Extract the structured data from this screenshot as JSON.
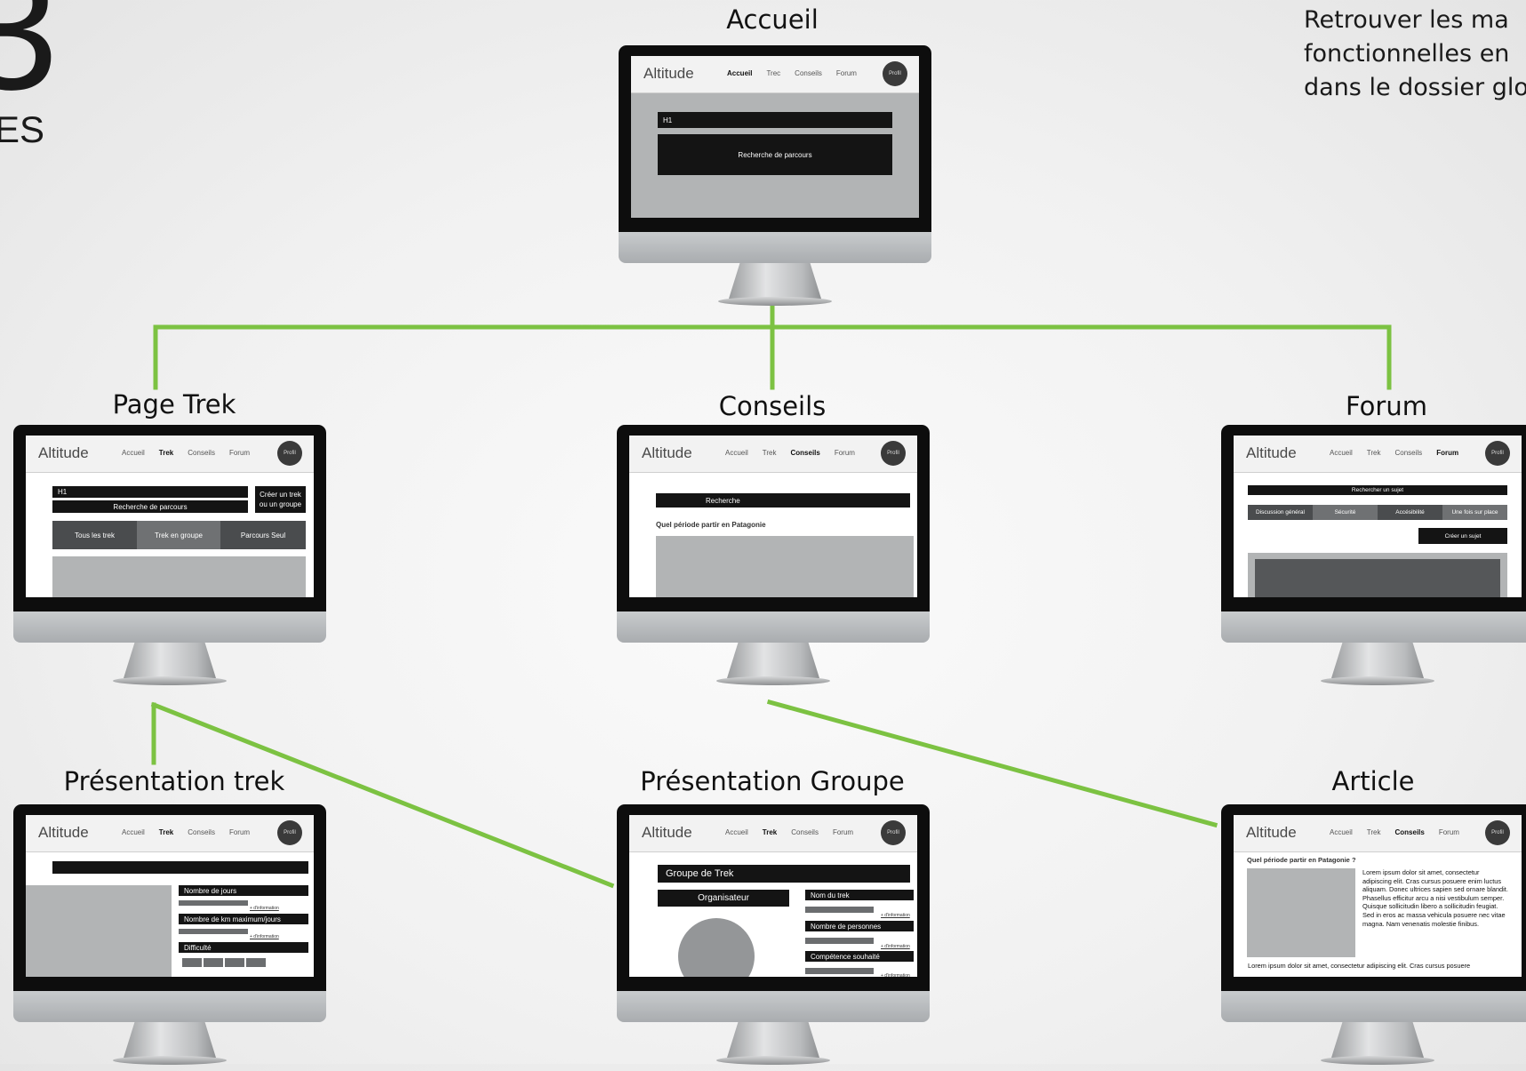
{
  "header": {
    "number": "3",
    "subtitle": "ES"
  },
  "note": {
    "lines": [
      "Retrouver les ma",
      "fonctionnelles en",
      "dans le dossier glo"
    ]
  },
  "colors": {
    "connector": "#7cc242",
    "bezel": "#0d0d0d"
  },
  "site": {
    "logo": "Altitude",
    "nav": [
      "Accueil",
      "Trek",
      "Conseils",
      "Forum"
    ],
    "profile": "Profil"
  },
  "pages": {
    "accueil": {
      "label": "Accueil",
      "nav": [
        "Accueil",
        "Trec",
        "Conseils",
        "Forum"
      ],
      "h1": "H1",
      "search": "Recherche de parcours"
    },
    "page_trek": {
      "label": "Page Trek",
      "h1": "H1",
      "search": "Recherche de parcours",
      "create_line1": "Créer un trek",
      "create_line2": "ou un groupe",
      "tabs": [
        "Tous les trek",
        "Trek en groupe",
        "Parcours Seul"
      ]
    },
    "conseils": {
      "label": "Conseils",
      "search": "Recherche",
      "heading": "Quel période partir en Patagonie"
    },
    "forum": {
      "label": "Forum",
      "search": "Rechercher un sujet",
      "tabs": [
        "Discussion général",
        "Sécurité",
        "Accésibilité",
        "Une fois sur place"
      ],
      "create": "Créer un sujet"
    },
    "presentation_trek": {
      "label": "Présentation trek",
      "fields": [
        "Nombre de jours",
        "Nombre de km maximum/jours",
        "Difficulté"
      ],
      "more": "+ d'information"
    },
    "presentation_groupe": {
      "label": "Présentation Groupe",
      "title": "Groupe de Trek",
      "organizer": "Organisateur",
      "fields": [
        "Nom du trek",
        "Nombre de personnes",
        "Compétence souhaité"
      ],
      "more": "+ d'information"
    },
    "article": {
      "label": "Article",
      "heading": "Quel période partir en Patagonie ?",
      "body": "Lorem ipsum dolor sit amet, consectetur adipiscing elit. Cras cursus posuere enim luctus aliquam. Donec ultrices sapien sed ornare blandit. Phasellus efficitur arcu a nisi vestibulum semper. Quisque sollicitudin libero a sollicitudin feugiat. Sed in eros ac massa vehicula posuere nec vitae magna. Nam venenatis molestie finibus.",
      "footer_line": "Lorem ipsum dolor sit amet, consectetur adipiscing elit. Cras cursus posuere"
    }
  }
}
